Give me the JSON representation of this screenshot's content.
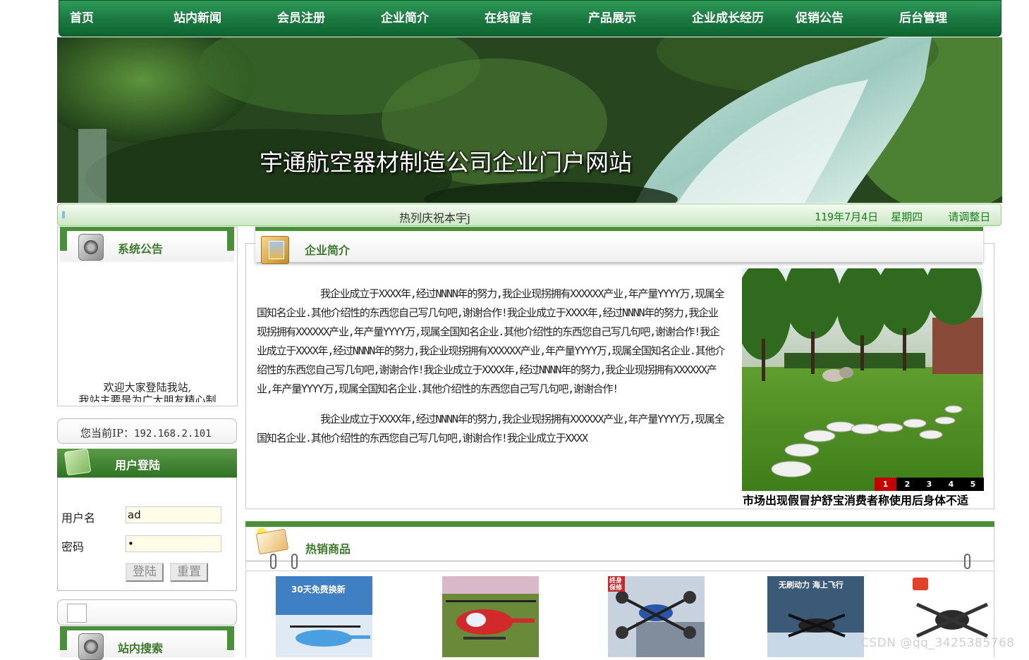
{
  "nav": {
    "items": [
      "首页",
      "站内新闻",
      "会员注册",
      "企业简介",
      "在线留言",
      "产品展示",
      "企业成长经历",
      "促销公告",
      "后台管理"
    ]
  },
  "banner": {
    "title": "宇通航空器材制造公司企业门户网站"
  },
  "marquee": {
    "notice": "热列庆祝本宇j",
    "date": "119年7月4日",
    "weekday": "星期四",
    "tip": "请调整日期!"
  },
  "left": {
    "system_notice": {
      "title": "系统公告",
      "text_line1": "欢迎大家登陆我站,",
      "text_line2": "我站主要是为广大朋友精心制"
    },
    "ip": {
      "label": "您当前IP：",
      "value": "192.168.2.101"
    },
    "login": {
      "title": "用户登陆",
      "username_label": "用户名",
      "username_value": "ad",
      "password_label": "密码",
      "password_value": "•",
      "login_button": "登陆",
      "reset_button": "重置"
    },
    "search": {
      "title": "站内搜索"
    }
  },
  "intro": {
    "title": "企业简介",
    "paragraphs": [
      "我企业成立于XXXX年,经过NNNN年的努力,我企业现拐拥有XXXXXX产业,年产量YYYY万,现属全国知名企业.其他介绍性的东西您自己写几句吧,谢谢合作!我企业成立于XXXX年,经过NNNN年的努力,我企业现拐拥有XXXXXX产业,年产量YYYY万,现属全国知名企业.其他介绍性的东西您自己写几句吧,谢谢合作!我企业成立于XXXX年,经过NNNN年的努力,我企业现拐拥有XXXXXX产业,年产量YYYY万,现属全国知名企业.其他介绍性的东西您自己写几句吧,谢谢合作!我企业成立于XXXX年,经过NNNN年的努力,我企业现拐拥有XXXXXX产业,年产量YYYY万,现属全国知名企业.其他介绍性的东西您自己写几句吧,谢谢合作!",
      "我企业成立于XXXX年,经过NNNN年的努力,我企业现拐拥有XXXXXX产业,年产量YYYY万,现属全国知名企业.其他介绍性的东西您自己写几句吧,谢谢合作!我企业成立于XXXX"
    ],
    "slides": [
      "1",
      "2",
      "3",
      "4",
      "5"
    ],
    "active_slide": "1",
    "caption": "市场出现假冒护舒宝消费者称使用后身体不适"
  },
  "hot": {
    "title": "热销商品",
    "product_texts": {
      "p1": "30天免费换新",
      "p3": "终身保修",
      "p4": "无刷动力 海上飞行"
    }
  },
  "watermark": "CSDN @qq_3425385768",
  "colors": {
    "nav_green": "#1d7d43",
    "accent_green": "#4a8f3a",
    "date_green": "#18801c"
  }
}
